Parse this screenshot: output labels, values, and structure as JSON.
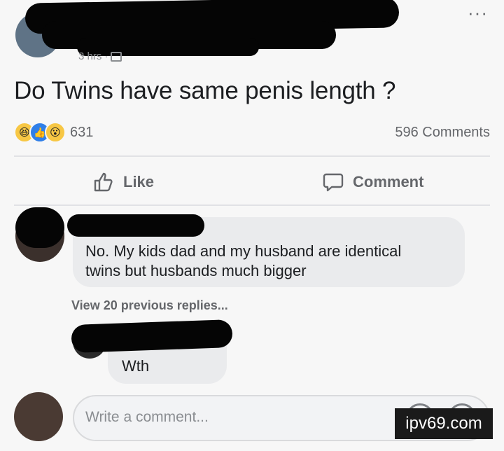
{
  "post": {
    "timestamp": "3 hrs",
    "text": "Do Twins have same penis length ?",
    "reaction_count": "631",
    "comment_count": "596 Comments",
    "more_icon": "more-options-icon"
  },
  "actions": {
    "like_label": "Like",
    "comment_label": "Comment"
  },
  "comments": [
    {
      "text_line1": "No. My kids dad and my husband are identical",
      "text_line2": "twins but husbands much bigger"
    }
  ],
  "view_replies": "View 20 previous replies...",
  "reply": {
    "text": "Wth"
  },
  "composer": {
    "placeholder": "Write a comment..."
  },
  "watermark": "ipv69.com",
  "colors": {
    "secondary_text": "#65676b",
    "like_blue": "#2f7fe8",
    "reaction_yellow": "#f7c744"
  }
}
